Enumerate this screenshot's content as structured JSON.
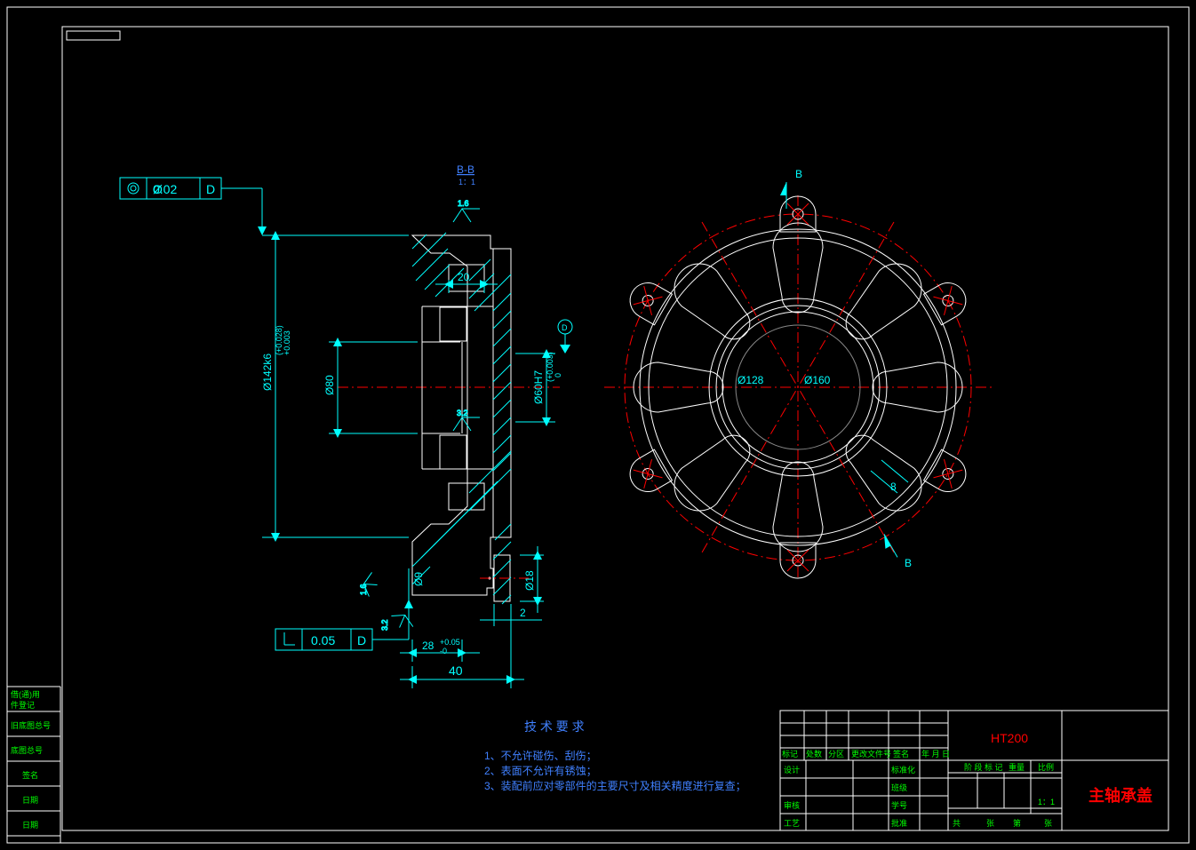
{
  "view_label": "B-B",
  "view_scale": "1：1",
  "tolerances": {
    "concentricity": {
      "value": "0.02",
      "datum": "D"
    },
    "perpendicularity": {
      "value": "0.05",
      "datum": "D"
    }
  },
  "surface_finish": {
    "sf1": "1.6",
    "sf2": "3.2",
    "sf3": "1.6",
    "sf4": "3.2"
  },
  "dimensions": {
    "d142": "Ø142k6",
    "d142_tol_upper": "+0.028",
    "d142_tol_lower": "+0.003",
    "d80": "Ø80",
    "d60": "Ø60H7",
    "d60_tol_upper": "+0.003",
    "d60_tol_lower": "0",
    "d9": "Ø9",
    "d18": "Ø18",
    "d128": "Ø128",
    "d160": "Ø160",
    "n20": "20",
    "n28": "28",
    "n28_tol_upper": "+0.05",
    "n28_tol_lower": "-0",
    "n40": "40",
    "n2": "2",
    "n8": "8"
  },
  "datum": "D",
  "section_marks": {
    "top": "B",
    "bottom": "B"
  },
  "tech_req": {
    "title": "技 术 要 求",
    "r1": "1、不允许碰伤、刮伤；",
    "r2": "2、表面不允许有锈蚀；",
    "r3": "3、装配前应对零部件的主要尺寸及相关精度进行复查；"
  },
  "title_block": {
    "material": "HT200",
    "part_name": "主轴承盖",
    "scale": "1：1",
    "headers": {
      "h1": "标记",
      "h2": "处数",
      "h3": "分区",
      "h4": "更改文件号",
      "h5": "签名",
      "h6": "年 月 日",
      "h7": "设计",
      "h8": "标准化",
      "h9": "审核",
      "h10": "工艺",
      "h11": "批准",
      "h12": "学号",
      "h13": "班级",
      "h14": "阶 段 标 记",
      "h15": "重量",
      "h16": "比例",
      "h17": "共",
      "h18": "张",
      "h19": "第",
      "h20": "张"
    }
  },
  "rev_block": {
    "r1": "借(通)用",
    "r2": "件登记",
    "r3": "旧底图总号",
    "r4": "底图总号",
    "r5": "签名",
    "r6": "日期",
    "r7": "日期"
  }
}
